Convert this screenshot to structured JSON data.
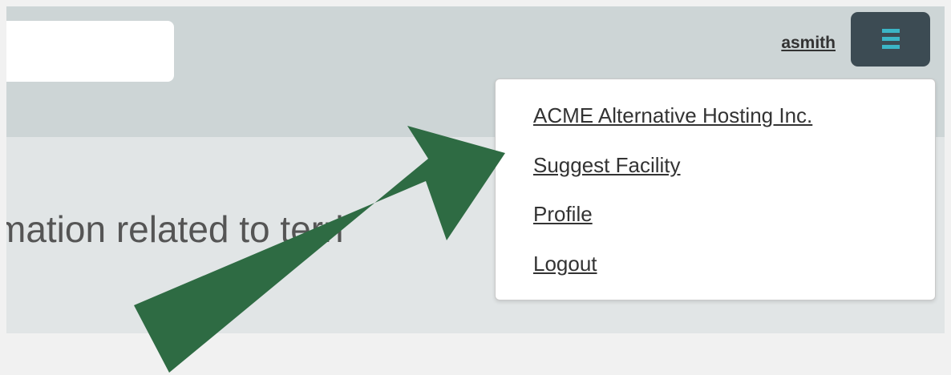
{
  "header": {
    "search_value": "",
    "username": "asmith",
    "menu_icon": "hamburger-icon"
  },
  "menu": {
    "items": [
      {
        "label": "ACME Alternative Hosting Inc."
      },
      {
        "label": "Suggest Facility"
      },
      {
        "label": "Profile"
      },
      {
        "label": "Logout"
      }
    ]
  },
  "content": {
    "partial_heading": "mation related to terri"
  },
  "annotation": {
    "arrow_color": "#2e6b43",
    "arrow_target": "Suggest Facility"
  },
  "colors": {
    "header_bg": "#cdd5d6",
    "content_bg": "#e1e5e6",
    "toggle_bg": "#3c4b53",
    "toggle_bars": "#3bb5c6"
  }
}
